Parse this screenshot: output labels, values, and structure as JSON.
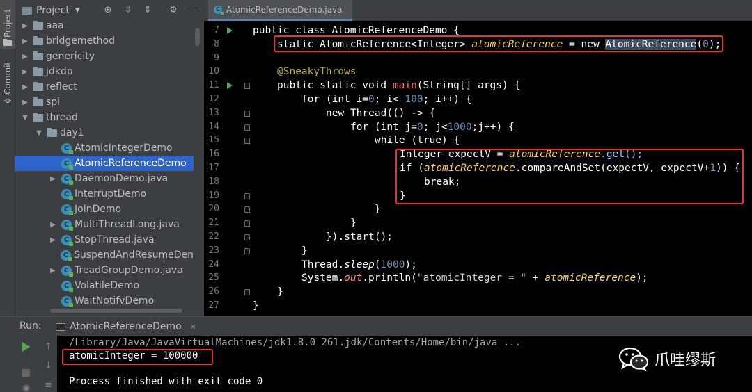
{
  "tool_strip": {
    "project_tab": "Project",
    "commit_tab": "Commit"
  },
  "project_panel": {
    "title": "Project",
    "tree": [
      {
        "label": "aaa",
        "kind": "package",
        "expandable": true,
        "expanded": false,
        "depth": 0
      },
      {
        "label": "bridgemethod",
        "kind": "package",
        "expandable": true,
        "expanded": false,
        "depth": 0
      },
      {
        "label": "genericity",
        "kind": "package",
        "expandable": true,
        "expanded": false,
        "depth": 0
      },
      {
        "label": "jdkdp",
        "kind": "package",
        "expandable": true,
        "expanded": false,
        "depth": 0
      },
      {
        "label": "reflect",
        "kind": "package",
        "expandable": true,
        "expanded": false,
        "depth": 0
      },
      {
        "label": "spi",
        "kind": "package",
        "expandable": true,
        "expanded": false,
        "depth": 0
      },
      {
        "label": "thread",
        "kind": "package",
        "expandable": true,
        "expanded": true,
        "depth": 0
      },
      {
        "label": "day1",
        "kind": "package",
        "expandable": true,
        "expanded": true,
        "depth": 1
      },
      {
        "label": "AtomicIntegerDemo",
        "kind": "class",
        "expandable": false,
        "depth": 2
      },
      {
        "label": "AtomicReferenceDemo",
        "kind": "class",
        "expandable": false,
        "depth": 2,
        "selected": true
      },
      {
        "label": "DaemonDemo.java",
        "kind": "class",
        "expandable": true,
        "expanded": false,
        "depth": 2
      },
      {
        "label": "InterruptDemo",
        "kind": "class",
        "expandable": false,
        "depth": 2
      },
      {
        "label": "JoinDemo",
        "kind": "class",
        "expandable": false,
        "depth": 2
      },
      {
        "label": "MultiThreadLong.java",
        "kind": "class",
        "expandable": true,
        "expanded": false,
        "depth": 2
      },
      {
        "label": "StopThread.java",
        "kind": "class",
        "expandable": true,
        "expanded": false,
        "depth": 2
      },
      {
        "label": "SuspendAndResumeDen",
        "kind": "class",
        "expandable": false,
        "depth": 2
      },
      {
        "label": "TreadGroupDemo.java",
        "kind": "class",
        "expandable": true,
        "expanded": false,
        "depth": 2
      },
      {
        "label": "VolatileDemo",
        "kind": "class",
        "expandable": false,
        "depth": 2
      },
      {
        "label": "WaitNotifvDemo",
        "kind": "class",
        "expandable": false,
        "depth": 2
      }
    ]
  },
  "editor": {
    "tab_label": "AtomicReferenceDemo.java",
    "line_numbers": [
      "7",
      "8",
      "9",
      "10",
      "11",
      "12",
      "13",
      "14",
      "15",
      "16",
      "17",
      "18",
      "19",
      "20",
      "21",
      "22",
      "23",
      "24",
      "25",
      "26",
      "27"
    ],
    "run_gutter_lines": [
      "7",
      "11"
    ],
    "fold_gutter_lines": [
      "11",
      "13",
      "14",
      "15",
      "19",
      "20",
      "21",
      "22",
      "23",
      "26"
    ],
    "code": {
      "l7_kw": "public class ",
      "l7_name": "AtomicReferenceDemo {",
      "l8_a": "static AtomicReference<Integer> ",
      "l8_field": "atomicReference",
      "l8_b": " = new ",
      "l8_type": "AtomicReference",
      "l8_c": "(",
      "l8_num": "0",
      "l8_d": ");",
      "l10_ann": "@SneakyThrows",
      "l11_a": "public static void ",
      "l11_fn": "main",
      "l11_b": "(String[] args) {",
      "l12_a": "for (int i=",
      "l12_n0": "0",
      "l12_b": "; i< ",
      "l12_n1": "100",
      "l12_c": "; i++) {",
      "l13": "new Thread(() -> {",
      "l14_a": "for (int j=",
      "l14_n0": "0",
      "l14_b": "; j<",
      "l14_n1": "1000",
      "l14_c": ";j++) {",
      "l15": "while (true) {",
      "l16_a": "Integer expectV = ",
      "l16_field": "atomicReference",
      "l16_b": ".get();",
      "l17_a": "if (",
      "l17_field": "atomicReference",
      "l17_b": ".compareAndSet(expectV, expectV+",
      "l17_num": "1",
      "l17_c": ")) {",
      "l18": "break;",
      "l19": "}",
      "l20": "}",
      "l21": "}",
      "l22": "}).start();",
      "l23": "}",
      "l24_a": "Thread.",
      "l24_m": "sleep",
      "l24_b": "(",
      "l24_n": "1000",
      "l24_c": ");",
      "l25_a": "System.",
      "l25_out": "out",
      "l25_b": ".println(",
      "l25_str": "\"atomicInteger = \"",
      "l25_c": " + ",
      "l25_field": "atomicReference",
      "l25_d": ");",
      "l26": "}",
      "l27": "}"
    }
  },
  "run_panel": {
    "label": "Run:",
    "tab_label": "AtomicReferenceDemo",
    "console": {
      "path_line": "/Library/Java/JavaVirtualMachines/jdk1.8.0_261.jdk/Contents/Home/bin/java ...",
      "output_line": "atomicInteger = 100000",
      "exit_line": "Process finished with exit code 0"
    }
  },
  "watermark": {
    "text": "爪哇缪斯"
  },
  "colors": {
    "highlight_box": "#e8332a",
    "selection": "#2f65ca",
    "run_green": "#4fa84f"
  }
}
